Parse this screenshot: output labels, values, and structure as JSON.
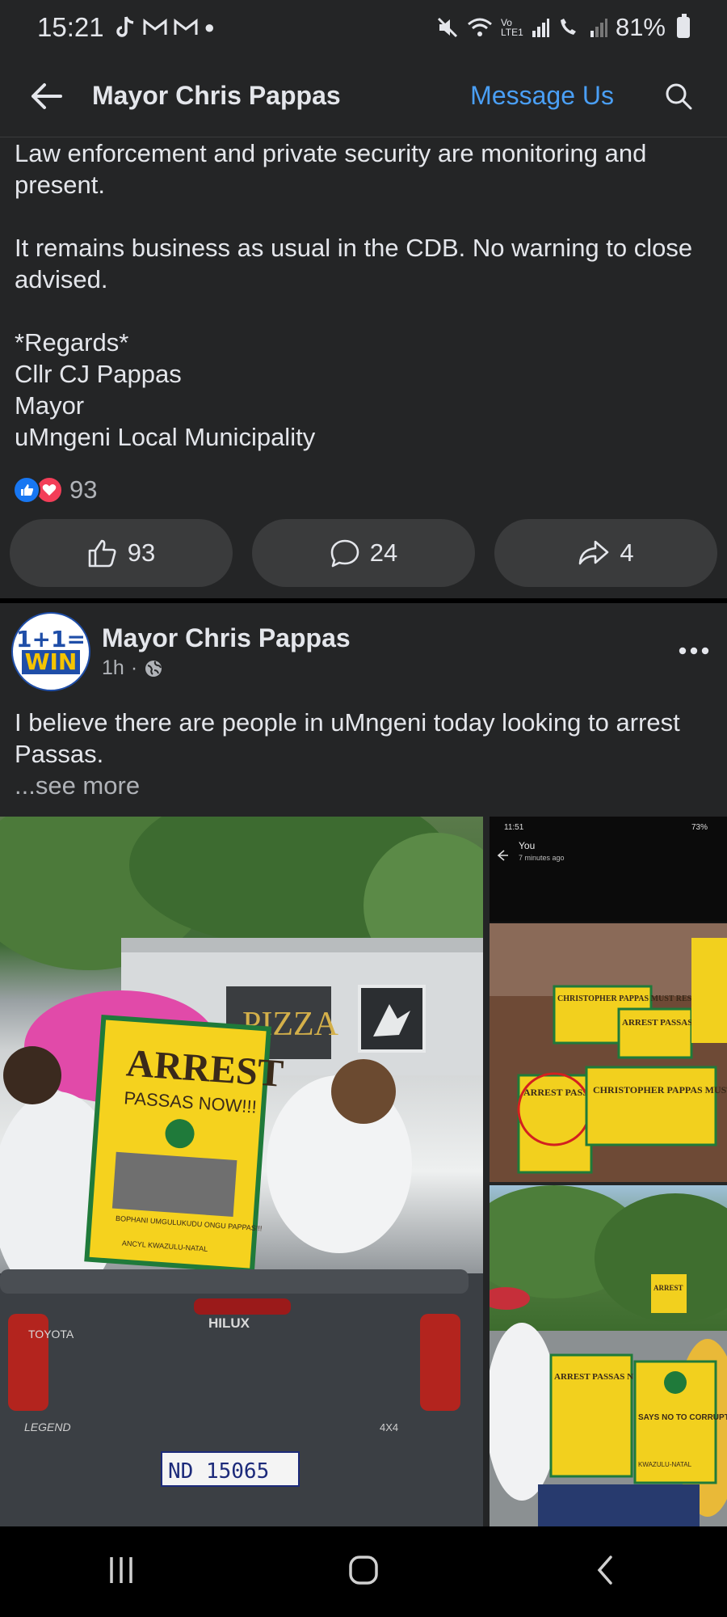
{
  "status_bar": {
    "time": "15:21",
    "battery": "81%",
    "left_icons": [
      "tiktok-icon",
      "gmail-icon",
      "gmail-icon",
      "dot-icon"
    ],
    "right_icons": [
      "mute-icon",
      "wifi-icon",
      "lte-signal-icon",
      "wifi-calling-icon",
      "signal-icon",
      "battery-icon"
    ],
    "lte_label": "Vo LTE1"
  },
  "app_bar": {
    "title": "Mayor Chris Pappas",
    "message_button": "Message Us"
  },
  "previous_post": {
    "paragraphs": [
      "Law enforcement and private security are monitoring and present.",
      "It remains business as usual in the CDB. No warning to close advised."
    ],
    "signature": [
      "*Regards*",
      "Cllr CJ Pappas",
      "Mayor",
      "uMngeni Local Municipality"
    ],
    "reaction_count": "93",
    "actions": {
      "like_count": "93",
      "comment_count": "24",
      "share_count": "4"
    }
  },
  "post": {
    "author": "Mayor Chris Pappas",
    "time": "1h",
    "separator": "·",
    "avatar_text_top": "1+1=",
    "avatar_text_bottom": "WIN",
    "text": "I believe there are people in uMngeni today looking to arrest Passas.",
    "see_more": "...see more"
  },
  "media": {
    "main_sign_line1": "ARREST",
    "main_sign_line2": "PASSAS NOW!!!",
    "main_sign_footer": "BOPHANI UMGULUKUDU ONGU PAPPAS!!!",
    "main_sign_org": "ANCYL KWAZULU-NATAL",
    "truck_brand": "TOYOTA",
    "truck_model": "HILUX",
    "truck_trim": "LEGEND",
    "truck_badge": "4X4",
    "plate": "ND 15065",
    "pizza_sign": "PIZZA",
    "screenshot_time": "11:51",
    "screenshot_battery": "73%",
    "screenshot_sender": "You",
    "screenshot_subtitle": "7 minutes ago",
    "r1_sign_a": "CHRISTOPHER PAPPAS MUST RESIGN",
    "r1_sign_b": "ARREST PASSAS NOW!!!",
    "r1_sign_c": "CHRISTOPHER PAPPAS MUST RESIGN",
    "r2_sign_a": "ARREST PASSAS NOW!!!",
    "r2_sign_b": "SAYS NO TO CORRUPTION",
    "r2_sign_b_org": "KWAZULU-NATAL",
    "r2_sign_c": "ARREST"
  },
  "colors": {
    "background": "#242526",
    "accent_link": "#4a9ff5",
    "like_blue": "#1877f2",
    "love_red": "#f33e58",
    "button_bg": "#3a3b3c"
  }
}
